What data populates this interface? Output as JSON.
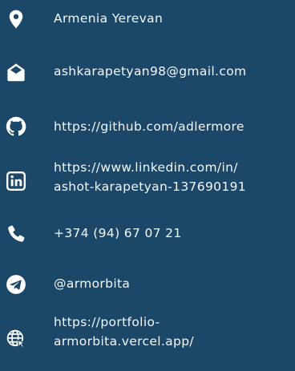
{
  "background_color": "#1b4869",
  "text_color": "#f4f7fa",
  "contacts": {
    "location": {
      "icon": "map-pin-icon",
      "text": "Armenia Yerevan"
    },
    "email": {
      "icon": "envelope-open-icon",
      "text": "ashkarapetyan98@gmail.com"
    },
    "github": {
      "icon": "github-icon",
      "text": "https://github.com/adlermore"
    },
    "linkedin": {
      "icon": "linkedin-icon",
      "line1": "https://www.linkedin.com/in/",
      "line2": "ashot-karapetyan-137690191"
    },
    "phone": {
      "icon": "phone-icon",
      "text": "+374 (94)  67  07  21"
    },
    "telegram": {
      "icon": "telegram-icon",
      "text": "@armorbita"
    },
    "portfolio": {
      "icon": "globe-cursor-icon",
      "line1": "https://portfolio-",
      "line2": "armorbita.vercel.app/"
    }
  }
}
